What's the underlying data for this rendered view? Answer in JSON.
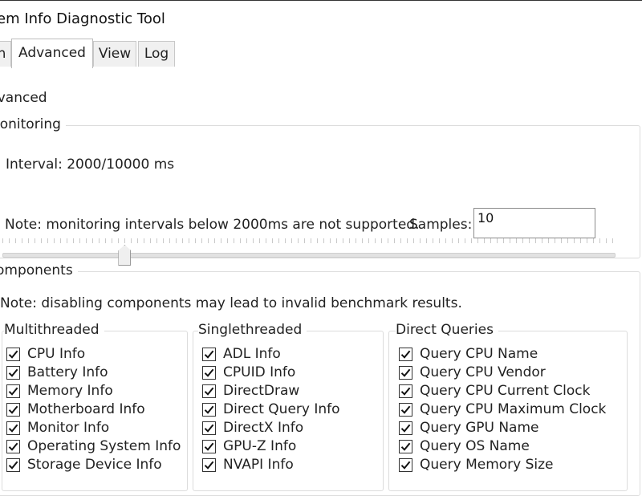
{
  "window": {
    "title": "em Info Diagnostic Tool"
  },
  "tabs": [
    {
      "label": "n",
      "active": false
    },
    {
      "label": "Advanced",
      "active": true
    },
    {
      "label": "View",
      "active": false
    },
    {
      "label": "Log",
      "active": false
    }
  ],
  "advanced": {
    "heading": "lvanced",
    "monitoring": {
      "legend": "lonitoring",
      "interval_label": "Interval: 2000/10000 ms",
      "interval_value": 2000,
      "interval_max": 10000,
      "note": "Note: monitoring intervals below 2000ms are not supported.",
      "samples_label": "Samples:",
      "samples_value": "10"
    },
    "components": {
      "legend": "omponents",
      "note": "Note: disabling components may lead to invalid benchmark results.",
      "groups": [
        {
          "title": "Multithreaded",
          "items": [
            {
              "label": "CPU Info",
              "checked": true
            },
            {
              "label": "Battery Info",
              "checked": true
            },
            {
              "label": "Memory Info",
              "checked": true
            },
            {
              "label": "Motherboard Info",
              "checked": true
            },
            {
              "label": "Monitor Info",
              "checked": true
            },
            {
              "label": "Operating System Info",
              "checked": true
            },
            {
              "label": "Storage Device Info",
              "checked": true
            }
          ]
        },
        {
          "title": "Singlethreaded",
          "items": [
            {
              "label": "ADL Info",
              "checked": true
            },
            {
              "label": "CPUID Info",
              "checked": true
            },
            {
              "label": "DirectDraw",
              "checked": true
            },
            {
              "label": "Direct Query Info",
              "checked": true
            },
            {
              "label": "DirectX Info",
              "checked": true
            },
            {
              "label": "GPU-Z Info",
              "checked": true
            },
            {
              "label": "NVAPI Info",
              "checked": true
            }
          ]
        },
        {
          "title": "Direct Queries",
          "items": [
            {
              "label": "Query CPU Name",
              "checked": true
            },
            {
              "label": "Query CPU Vendor",
              "checked": true
            },
            {
              "label": "Query CPU Current Clock",
              "checked": true
            },
            {
              "label": "Query CPU Maximum Clock",
              "checked": true
            },
            {
              "label": "Query GPU Name",
              "checked": true
            },
            {
              "label": "Query OS Name",
              "checked": true
            },
            {
              "label": "Query Memory Size",
              "checked": true
            }
          ]
        }
      ]
    }
  }
}
